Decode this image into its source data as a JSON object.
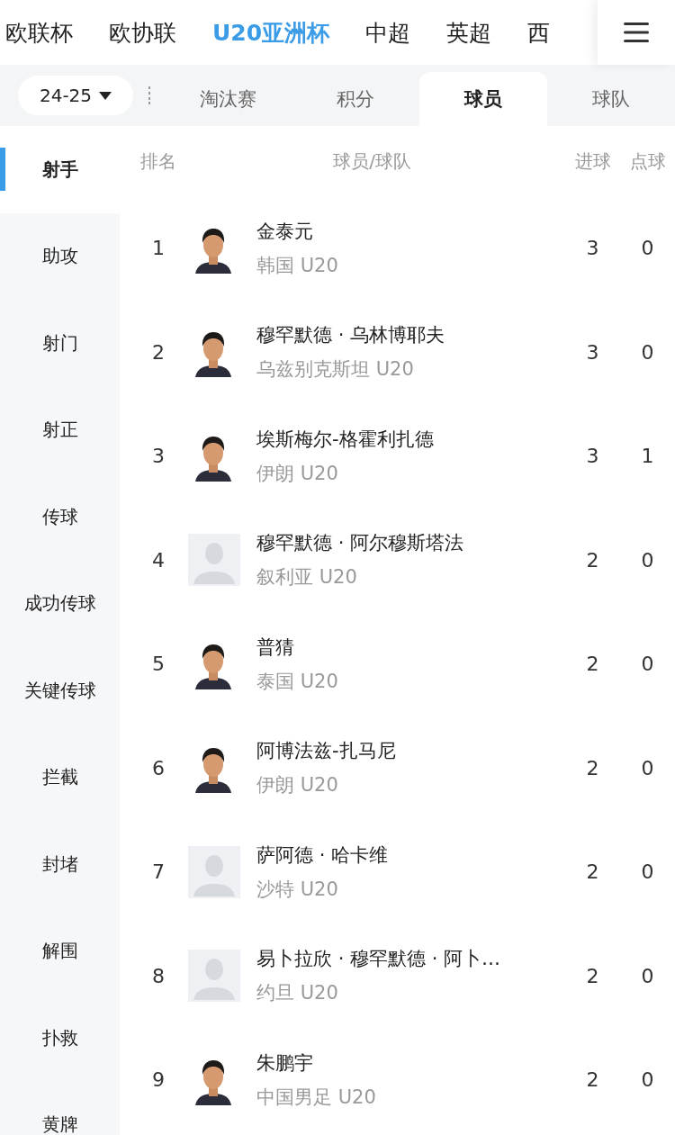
{
  "top_nav": [
    {
      "label": "欧联杯",
      "selected": false
    },
    {
      "label": "欧协联",
      "selected": false
    },
    {
      "label": "U20亚洲杯",
      "selected": true
    },
    {
      "label": "中超",
      "selected": false
    },
    {
      "label": "英超",
      "selected": false
    },
    {
      "label": "西",
      "selected": false
    }
  ],
  "season": {
    "value": "24-25"
  },
  "tabs": [
    {
      "label": "淘汰赛",
      "selected": false
    },
    {
      "label": "积分",
      "selected": false
    },
    {
      "label": "球员",
      "selected": true
    },
    {
      "label": "球队",
      "selected": false
    }
  ],
  "sidebar": {
    "items": [
      {
        "label": "射手",
        "selected": true
      },
      {
        "label": "助攻",
        "selected": false
      },
      {
        "label": "射门",
        "selected": false
      },
      {
        "label": "射正",
        "selected": false
      },
      {
        "label": "传球",
        "selected": false
      },
      {
        "label": "成功传球",
        "selected": false
      },
      {
        "label": "关键传球",
        "selected": false
      },
      {
        "label": "拦截",
        "selected": false
      },
      {
        "label": "封堵",
        "selected": false
      },
      {
        "label": "解围",
        "selected": false
      },
      {
        "label": "扑救",
        "selected": false
      },
      {
        "label": "黄牌",
        "selected": false
      }
    ]
  },
  "table": {
    "columns": [
      "排名",
      "球员/球队",
      "进球",
      "点球"
    ],
    "rows": [
      {
        "rank": "1",
        "name": "金泰元",
        "team": "韩国 U20",
        "goals": "3",
        "penalties": "0"
      },
      {
        "rank": "2",
        "name": "穆罕默德 · 乌林博耶夫",
        "team": "乌兹别克斯坦 U20",
        "goals": "3",
        "penalties": "0"
      },
      {
        "rank": "3",
        "name": "埃斯梅尔-格霍利扎德",
        "team": "伊朗 U20",
        "goals": "3",
        "penalties": "1"
      },
      {
        "rank": "4",
        "avatar": {
          "kind": "placeholder"
        },
        "name": "穆罕默德 · 阿尔穆斯塔法",
        "team": "叙利亚 U20",
        "goals": "2",
        "penalties": "0"
      },
      {
        "rank": "5",
        "name": "普猜",
        "team": "泰国 U20",
        "goals": "2",
        "penalties": "0"
      },
      {
        "rank": "6",
        "name": "阿博法兹-扎马尼",
        "team": "伊朗 U20",
        "goals": "2",
        "penalties": "0"
      },
      {
        "rank": "7",
        "avatar": {
          "kind": "placeholder"
        },
        "name": "萨阿德 · 哈卡维",
        "team": "沙特 U20",
        "goals": "2",
        "penalties": "0"
      },
      {
        "rank": "8",
        "avatar": {
          "kind": "placeholder"
        },
        "name": "易卜拉欣 · 穆罕默德 · 阿卜…",
        "team": "约旦 U20",
        "goals": "2",
        "penalties": "0"
      },
      {
        "rank": "9",
        "name": "朱鹏宇",
        "team": "中国男足 U20",
        "goals": "2",
        "penalties": "0"
      }
    ]
  }
}
